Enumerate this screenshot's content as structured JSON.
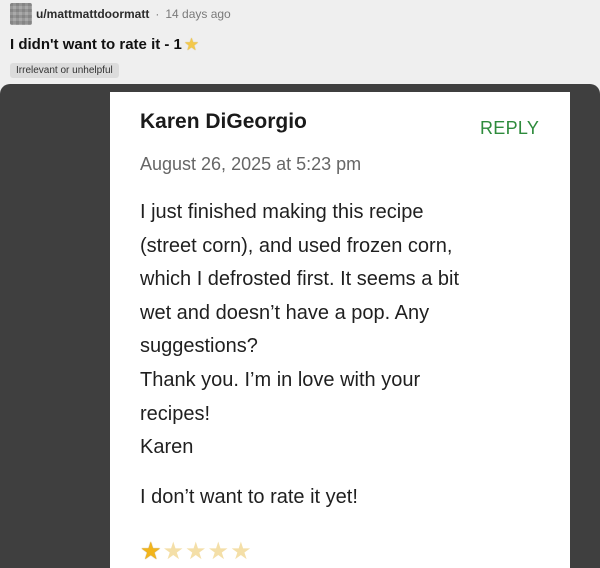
{
  "post": {
    "username": "u/mattmattdoormatt",
    "separator": "·",
    "time": "14 days ago",
    "title": "I didn't want to rate it - 1",
    "title_icon": "star-icon",
    "flair": "Irrelevant or unhelpful"
  },
  "comment": {
    "author": "Karen DiGeorgio",
    "reply_label": "REPLY",
    "date": "August 26, 2025 at 5:23 pm",
    "body_lines": [
      "I just finished making this recipe",
      "(street corn), and used frozen corn,",
      "which I defrosted first. It seems a bit",
      "wet and doesn’t have a pop. Any",
      "suggestions?",
      "Thank you. I’m in love with your",
      "recipes!",
      "Karen"
    ],
    "note": "I don’t want to rate it yet!",
    "rating": {
      "value": 1,
      "max": 5
    }
  },
  "colors": {
    "reply": "#2e8b3c",
    "star_filled": "#f2b51c",
    "star_empty": "#f4dfa8",
    "frame_background": "#3f3f3f"
  }
}
